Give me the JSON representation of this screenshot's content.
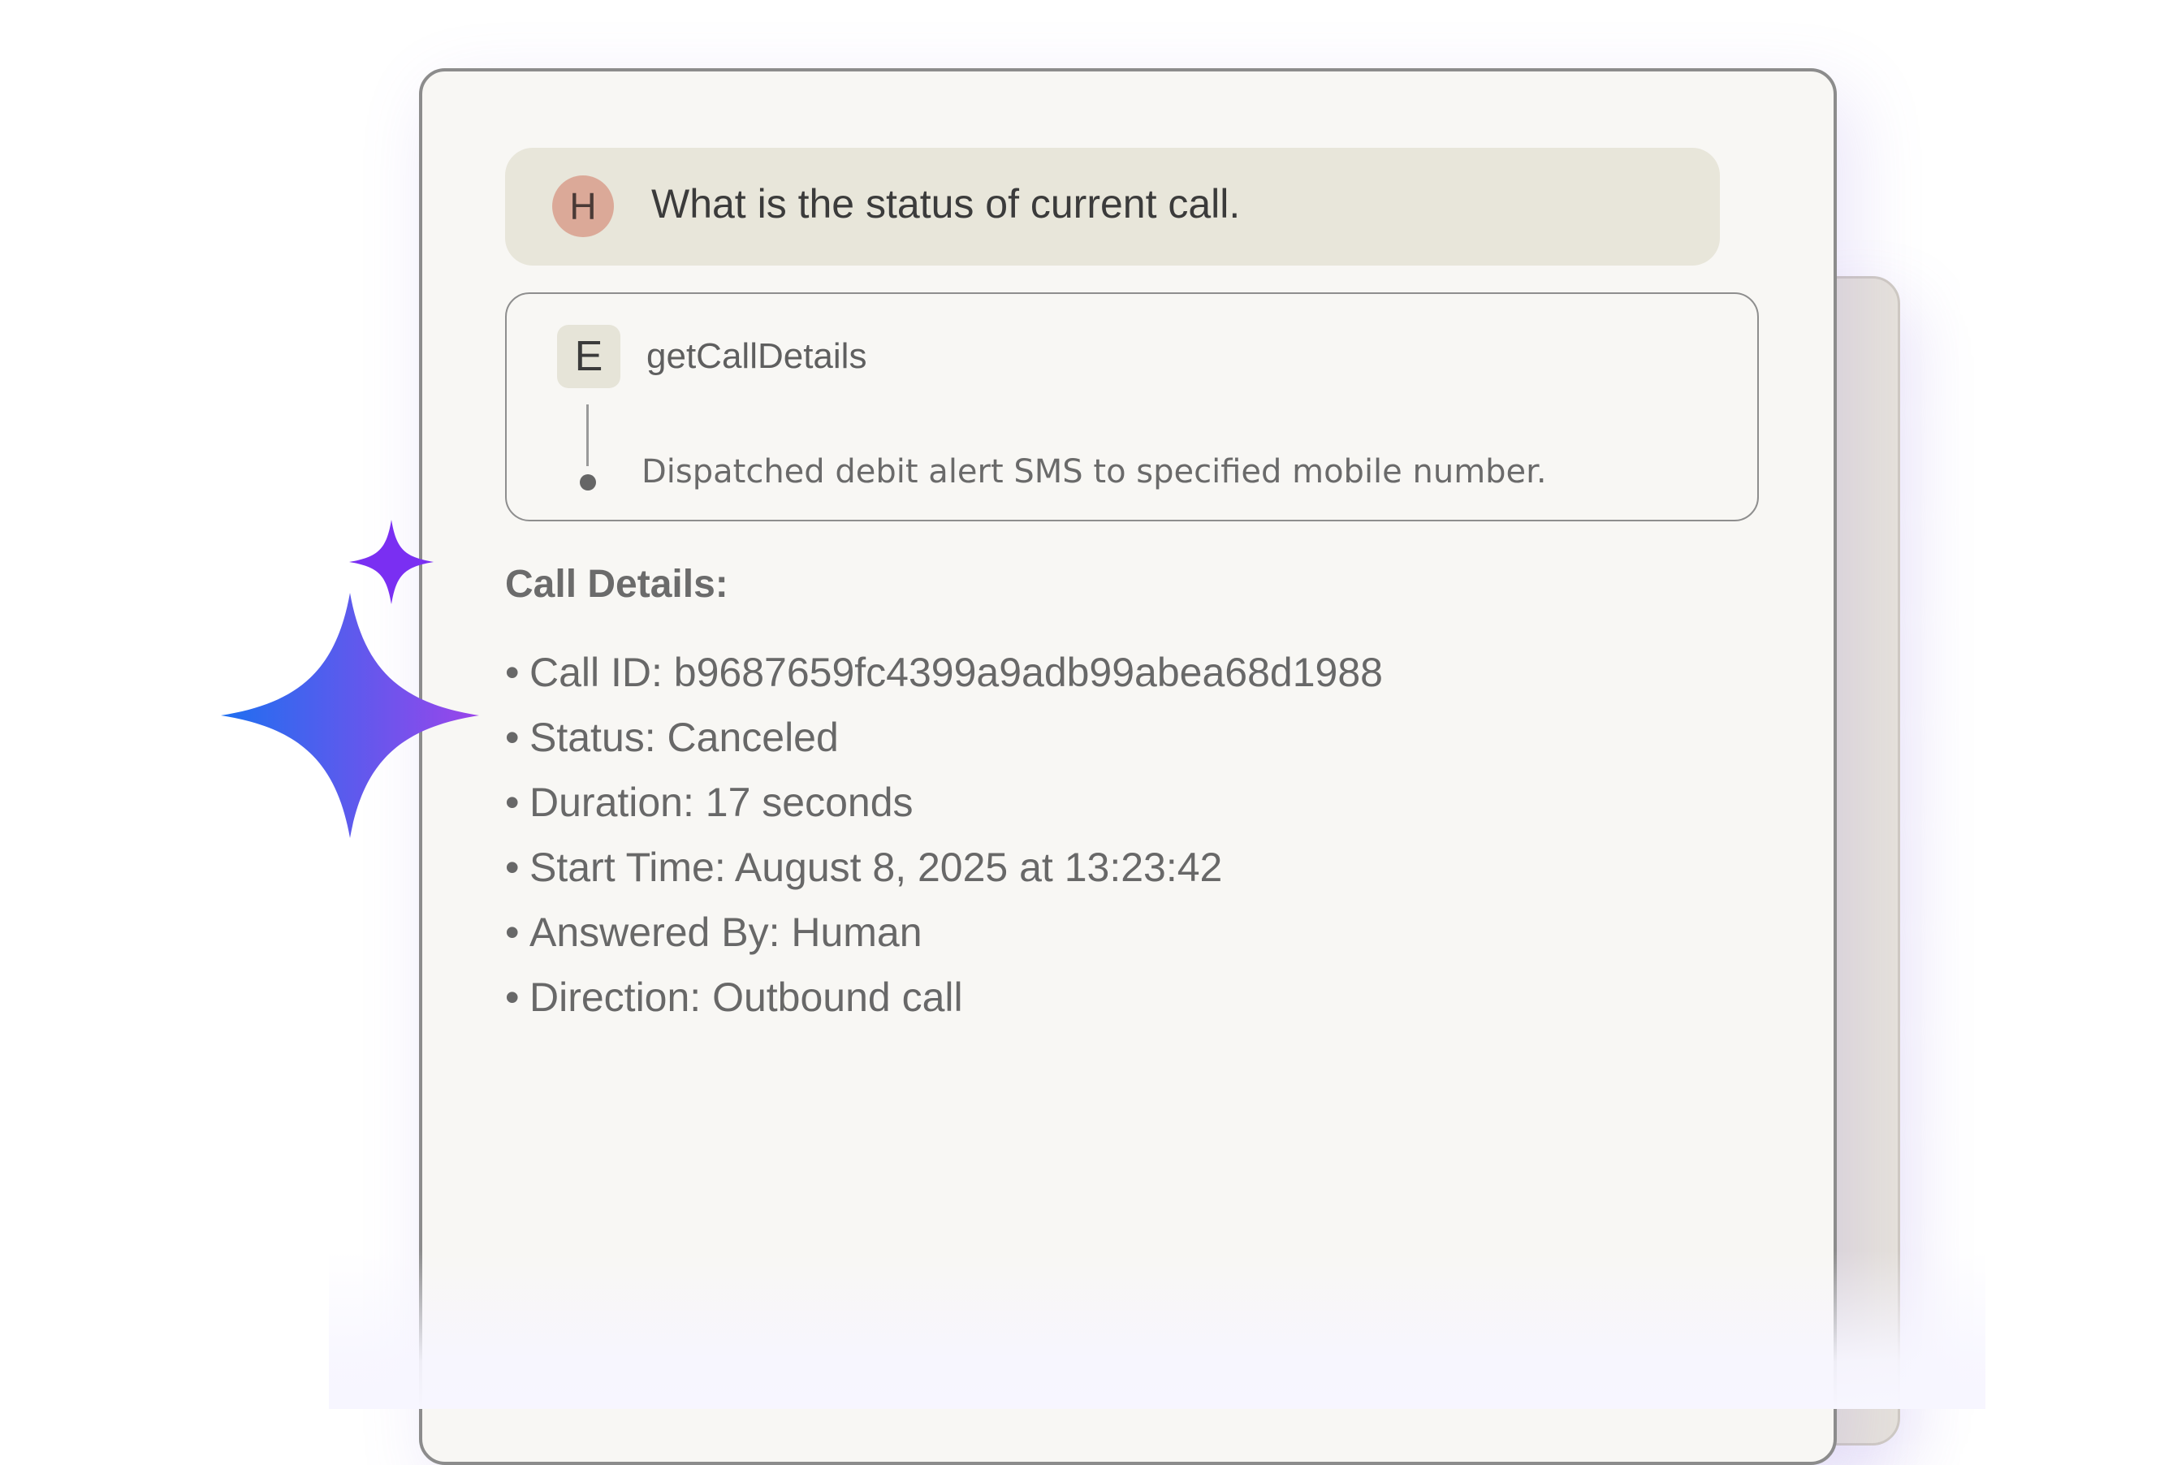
{
  "conversation": {
    "user_message": {
      "avatar_initial": "H",
      "text": "What is the status of current call."
    },
    "tool_call": {
      "badge": "E",
      "name": "getCallDetails",
      "result": "Dispatched debit alert SMS to specified mobile number."
    },
    "assistant_reply": {
      "heading": "Call Details:",
      "items": [
        "Call ID: b9687659fc4399a9adb99abea68d1988",
        "Status: Canceled",
        "Duration: 17 seconds",
        "Start Time: August 8, 2025 at 13:23:42",
        "Answered By: Human",
        "Direction: Outbound call"
      ]
    }
  },
  "decorations": {
    "sparkle_large": "sparkle-icon",
    "sparkle_small": "sparkle-icon",
    "colors": {
      "sparkle_gradient_start": "#1e6ff0",
      "sparkle_gradient_end": "#9b45ea",
      "sparkle_small": "#7a2ff2",
      "avatar_h": "#dba998",
      "user_bubble": "#e8e6da",
      "card_background": "#f8f7f4"
    }
  }
}
